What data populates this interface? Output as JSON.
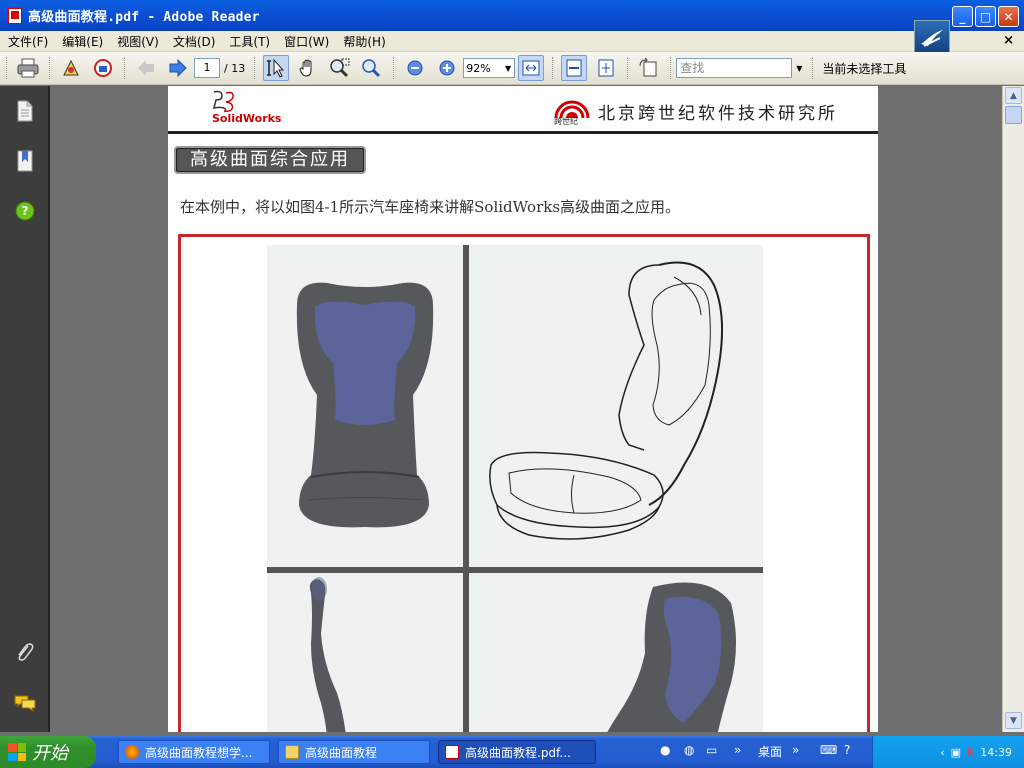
{
  "window": {
    "title": "高级曲面教程.pdf - Adobe Reader",
    "minimize": "_",
    "maximize": "□",
    "close": "✕"
  },
  "menu": {
    "items": [
      "文件(F)",
      "编辑(E)",
      "视图(V)",
      "文档(D)",
      "工具(T)",
      "窗口(W)",
      "帮助(H)"
    ],
    "close": "×"
  },
  "toolbar": {
    "current_page": "1",
    "total_pages": "/ 13",
    "zoom": "92%",
    "find_placeholder": "查找",
    "tool_status": "当前未选择工具"
  },
  "document": {
    "sw_brand": "SolidWorks",
    "institute": "北京跨世纪软件技术研究所",
    "institute_logo_text": "跨世纪",
    "section_title": "高级曲面综合应用",
    "intro": "在本例中，将以如图4-1所示汽车座椅来讲解SolidWorks高级曲面之应用。"
  },
  "taskbar": {
    "start": "开始",
    "tasks": [
      "高级曲面教程想学...",
      "高级曲面教程",
      "高级曲面教程.pdf..."
    ],
    "quicklaunch_label": "桌面",
    "clock": "14:39"
  },
  "colors": {
    "titlebar": "#0a52d4",
    "frame_red": "#c8282a",
    "seat_gray": "#55595c",
    "seat_blue": "#5d6499"
  }
}
